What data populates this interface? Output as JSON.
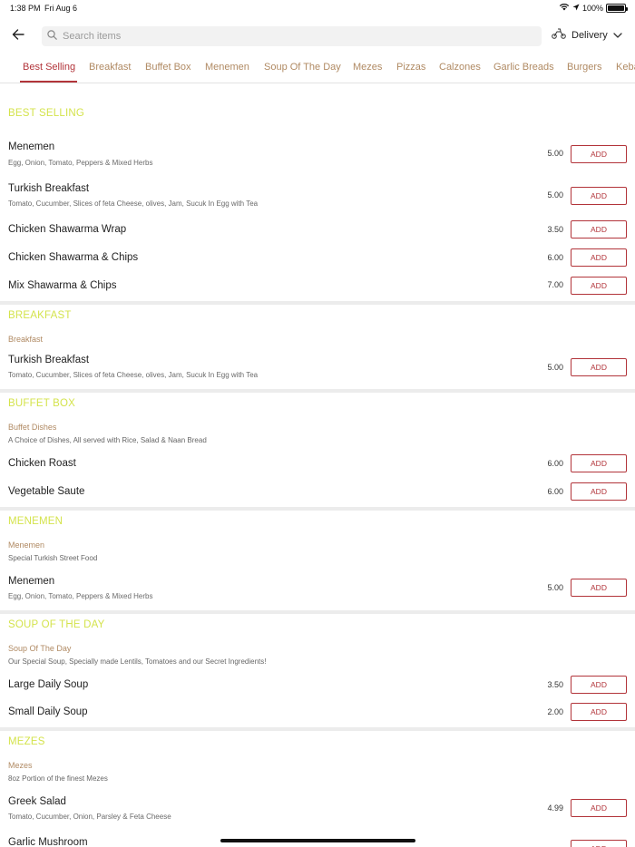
{
  "status_bar": {
    "time": "1:38 PM",
    "date": "Fri Aug 6",
    "battery": "100%"
  },
  "search": {
    "placeholder": "Search items"
  },
  "delivery": {
    "label": "Delivery"
  },
  "tabs": [
    "Best Selling",
    "Breakfast",
    "Buffet Box",
    "Menemen",
    "Soup Of The Day",
    "Mezes",
    "Pizzas",
    "Calzones",
    "Garlic Breads",
    "Burgers",
    "Kebabs"
  ],
  "active_tab": "Best Selling",
  "add_label": "ADD",
  "colors": {
    "accent": "#b2343a",
    "section_title": "#d4e34c",
    "tab_text": "#b08a63"
  },
  "sections": {
    "best_selling": {
      "title": "BEST SELLING",
      "items": [
        {
          "name": "Menemen",
          "desc": "Egg, Onion, Tomato, Peppers & Mixed Herbs",
          "price": "5.00"
        },
        {
          "name": "Turkish Breakfast",
          "desc": "Tomato, Cucumber, Slices of feta Cheese, olives, Jam, Sucuk In Egg with Tea",
          "price": "5.00"
        },
        {
          "name": "Chicken Shawarma Wrap",
          "price": "3.50"
        },
        {
          "name": "Chicken Shawarma & Chips",
          "price": "6.00"
        },
        {
          "name": "Mix Shawarma & Chips",
          "price": "7.00"
        }
      ]
    },
    "breakfast": {
      "title": "BREAKFAST",
      "subtitle": "Breakfast",
      "items": [
        {
          "name": "Turkish Breakfast",
          "desc": "Tomato, Cucumber, Slices of feta Cheese, olives, Jam, Sucuk In Egg with Tea",
          "price": "5.00"
        }
      ]
    },
    "buffet_box": {
      "title": "BUFFET BOX",
      "subtitle": "Buffet Dishes",
      "subdesc": "A Choice of Dishes, All served with Rice, Salad & Naan Bread",
      "items": [
        {
          "name": "Chicken Roast",
          "price": "6.00"
        },
        {
          "name": "Vegetable Saute",
          "price": "6.00"
        }
      ]
    },
    "menemen": {
      "title": "MENEMEN",
      "subtitle": "Menemen",
      "subdesc": "Special Turkish Street Food",
      "items": [
        {
          "name": "Menemen",
          "desc": "Egg, Onion, Tomato, Peppers & Mixed Herbs",
          "price": "5.00"
        }
      ]
    },
    "soup": {
      "title": "SOUP OF THE DAY",
      "subtitle": "Soup Of The Day",
      "subdesc": "Our Special Soup, Specially made Lentils, Tomatoes and our Secret Ingredients!",
      "items": [
        {
          "name": "Large Daily Soup",
          "price": "3.50"
        },
        {
          "name": "Small Daily Soup",
          "price": "2.00"
        }
      ]
    },
    "mezes": {
      "title": "MEZES",
      "subtitle": "Mezes",
      "subdesc": "8oz Portion of the finest Mezes",
      "items": [
        {
          "name": "Greek Salad",
          "desc": "Tomato, Cucumber, Onion, Parsley & Feta Cheese",
          "price": "4.99"
        },
        {
          "name": "Garlic Mushroom"
        }
      ]
    }
  }
}
